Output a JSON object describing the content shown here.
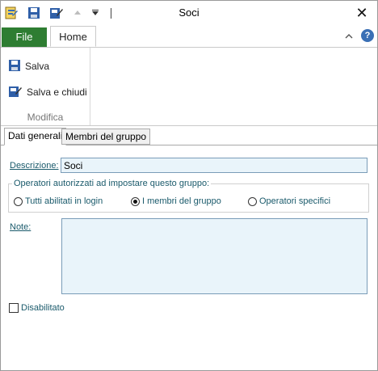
{
  "window": {
    "title": "Soci"
  },
  "ribbon": {
    "file_tab": "File",
    "home_tab": "Home",
    "buttons": {
      "save": "Salva",
      "save_close": "Salva e chiudi"
    },
    "group_label": "Modifica"
  },
  "tabs": [
    {
      "label": "Dati generali",
      "active": true
    },
    {
      "label": "Membri del gruppo",
      "active": false
    }
  ],
  "form": {
    "descrizione_label": "Descrizione:",
    "descrizione_value": "Soci",
    "operators_legend": "Operatori autorizzati ad impostare questo gruppo:",
    "radio_options": [
      "Tutti abilitati in login",
      "I membri del gruppo",
      "Operatori specifici"
    ],
    "selected_radio": "I membri del gruppo",
    "note_label": "Note:",
    "note_value": "",
    "disabled_label": "Disabilitato",
    "disabled_checked": false
  },
  "colors": {
    "file_tab": "#2e7d32",
    "field_label": "#1a5a6b",
    "input_bg": "#e9f4fa"
  }
}
